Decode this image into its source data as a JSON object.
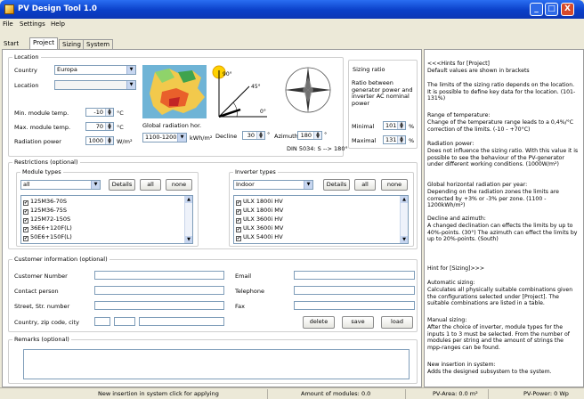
{
  "window": {
    "title": "PV Design Tool 1.0",
    "min": "_",
    "max": "□",
    "close": "X"
  },
  "menu": [
    "File",
    "Settings",
    "Help"
  ],
  "tabs": [
    "Start",
    "Project",
    "Sizing",
    "System"
  ],
  "location": {
    "title": "Location",
    "country_label": "Country",
    "country_value": "Europa",
    "location_label": "Location",
    "location_value": "",
    "min_temp_label": "Min. module temp.",
    "min_temp_value": "-10",
    "min_temp_unit": "°C",
    "max_temp_label": "Max. module temp.",
    "max_temp_value": "70",
    "max_temp_unit": "°C",
    "radiation_label": "Radiation power",
    "radiation_value": "1000",
    "radiation_unit": "W/m²",
    "global_radiation_label": "Global radiation hor.",
    "global_radiation_value": "1100-1200",
    "global_radiation_unit": "kWh/m²",
    "decline_label": "Decline",
    "decline_value": "30",
    "decline_unit": "°",
    "angle_90": "90°",
    "angle_45": "45°",
    "angle_0": "0°",
    "azimuth_label": "Azimuth",
    "azimuth_value": "180",
    "azimuth_unit": "°",
    "din": "DIN 5034: S --> 180°"
  },
  "sizing_ratio": {
    "title": "Sizing ratio",
    "description": "Ratio between generator power and inverter AC nominal power",
    "minimal_label": "Minimal",
    "minimal_value": "101",
    "maximal_label": "Maximal",
    "maximal_value": "131",
    "unit": "%"
  },
  "restrictions": {
    "title": "Restrictions (optional)",
    "modules": {
      "title": "Module types",
      "filter": "all",
      "details": "Details",
      "all": "all",
      "none": "none",
      "items": [
        "125M36-70S",
        "125M36-75S",
        "125M72-150S",
        "36E6+120F(L)",
        "50E6+150F(L)"
      ]
    },
    "inverters": {
      "title": "Inverter types",
      "filter": "Indoor",
      "details": "Details",
      "all": "all",
      "none": "none",
      "items": [
        "ULX 1800i HV",
        "ULX 1800i MV",
        "ULX 3600i HV",
        "ULX 3600i MV",
        "ULX 5400i HV"
      ]
    }
  },
  "customer": {
    "title": "Customer information (optional)",
    "number_label": "Customer Number",
    "contact_label": "Contact person",
    "street_label": "Street, Str. number",
    "country_label": "Country, zip code, city",
    "email_label": "Email",
    "telephone_label": "Telephone",
    "fax_label": "Fax",
    "delete": "delete",
    "save": "save",
    "load": "load"
  },
  "remarks": {
    "title": "Remarks (optional)"
  },
  "hints": {
    "header": "<<<Hints for [Project]",
    "subheader": "Default values are shown in brackets",
    "sizing_limits": "The limits of the sizing ratio depends on the location. It is possible to define key data for the location. (101-131%)",
    "temp_title": "Range of temperature:",
    "temp_text": "Change of the temperature range leads to a 0,4%/°C correction of the limits. (-10 - +70°C)",
    "rad_title": "Radiation power:",
    "rad_text": "Does not influence the sizing ratio. With this value it is possible to see the behaviour of the PV-generator under different working conditions. (1000W/m²)",
    "ghr_title": "Global horizontal radiation per year:",
    "ghr_text": "Depending on the radiation zones the limits are corrected by +3% or -3% per zone. (1100 - 1200kWh/m²)",
    "decl_title": "Decline and azimuth:",
    "decl_text": "A changed declination can effects the limits by up to 40%-points. (30°) The azimuth can effect the limits by up to 20%-points. (South)",
    "sizing_header": "Hint for [Sizing]>>>",
    "auto_title": "Automatic sizing:",
    "auto_text": "Calculates all physically suitable combinations given the configurations selected under [Project]. The suitable combinations are listed in a table.",
    "manual_title": "Manual sizing:",
    "manual_text": "After the choice of inverter, module types for the inputs 1 to 3 must be selected. From the number of modules per string and the amount of strings the mpp-ranges can be found.",
    "new_title": "New insertion in system:",
    "new_text": "Adds the designed subsystem to the system."
  },
  "status": {
    "hint": "New insertion in system click for applying",
    "modules": "Amount of modules: 0.0",
    "area": "PV-Area: 0.0 m²",
    "power": "PV-Power: 0 Wp"
  }
}
